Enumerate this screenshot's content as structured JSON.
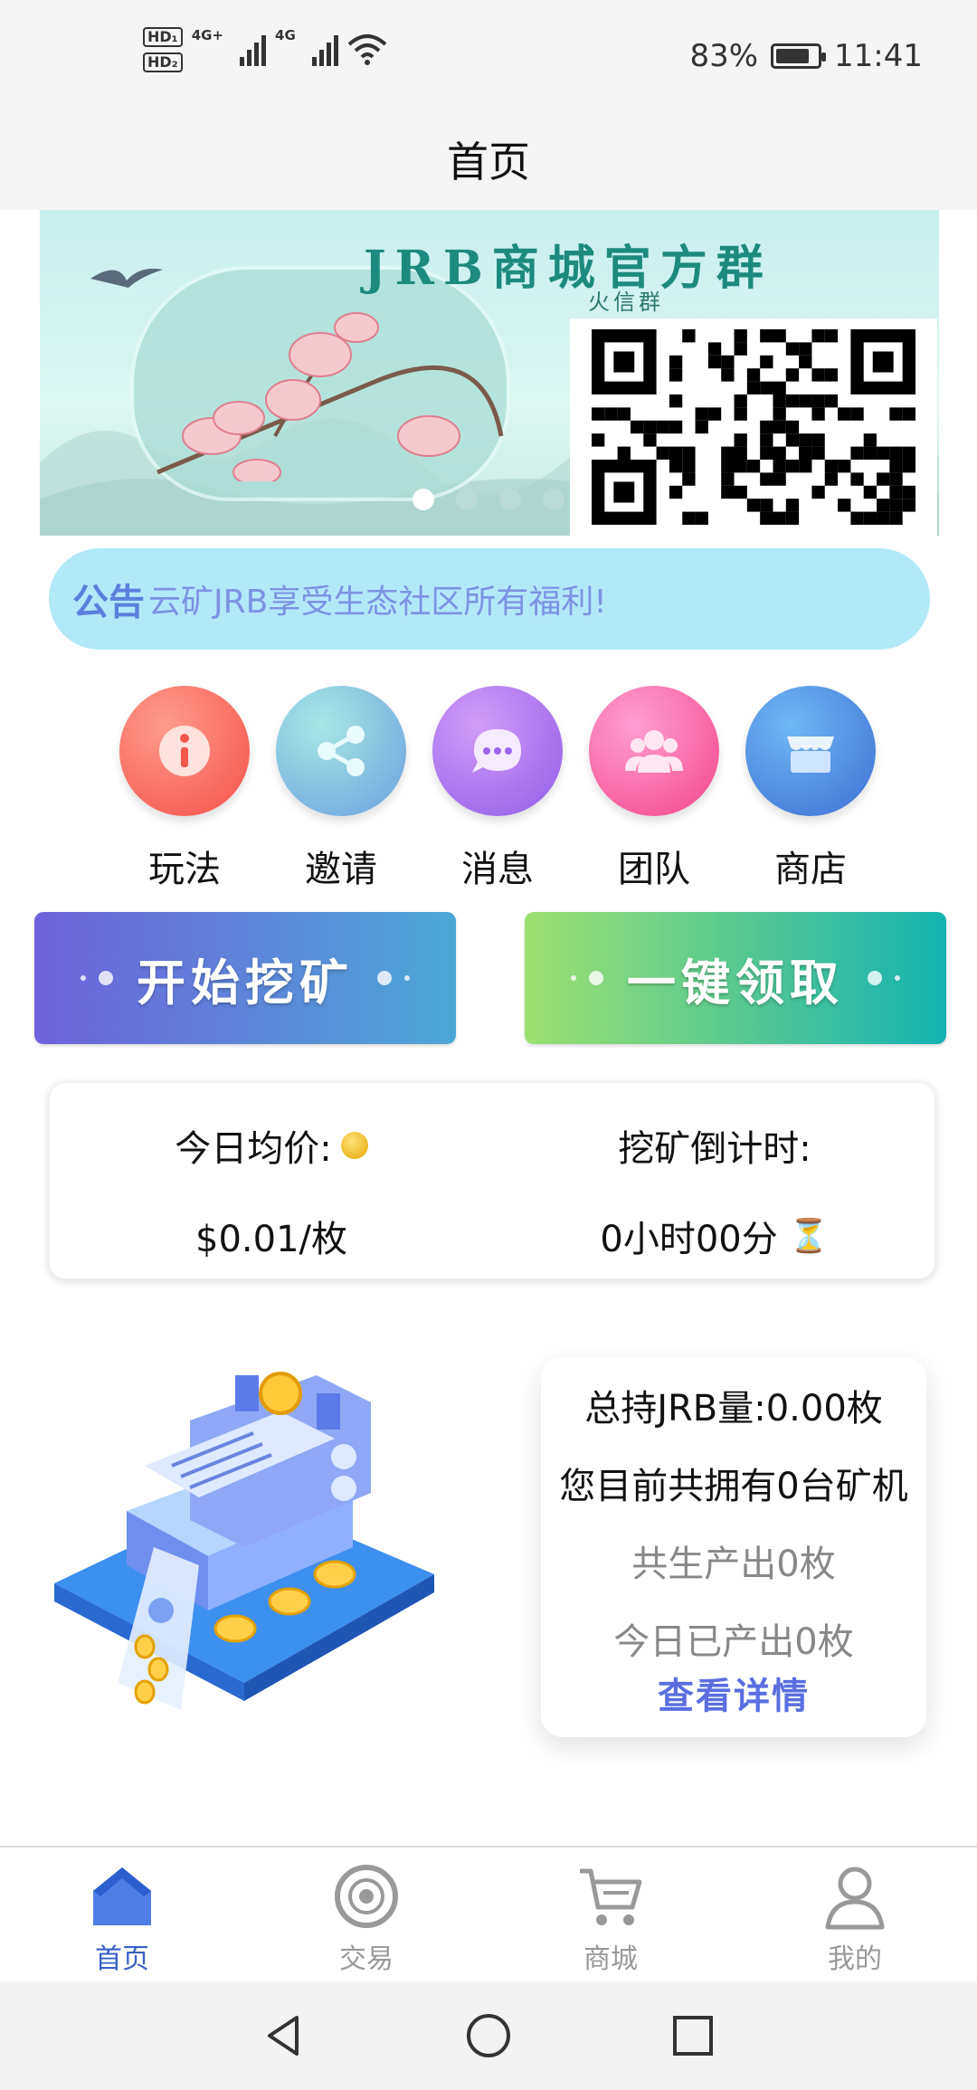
{
  "status_bar": {
    "hd1": "HD₁",
    "hd2": "HD₂",
    "net1": "4G+",
    "net2": "4G",
    "battery_text": "83%",
    "battery_level": 0.83,
    "time": "11:41"
  },
  "header": {
    "title": "首页"
  },
  "banner": {
    "title": "JRB商城官方群",
    "subtitle": "火信群",
    "slide_count": 4,
    "active_slide": 0
  },
  "notice": {
    "tag": "公告",
    "text": "云矿JRB享受生态社区所有福利!"
  },
  "shortcuts": [
    {
      "label": "玩法",
      "icon": "info-icon"
    },
    {
      "label": "邀请",
      "icon": "share-icon"
    },
    {
      "label": "消息",
      "icon": "chat-icon"
    },
    {
      "label": "团队",
      "icon": "team-icon"
    },
    {
      "label": "商店",
      "icon": "store-icon"
    }
  ],
  "actions": {
    "start_mining": "开始挖矿",
    "claim_all": "一键领取"
  },
  "price_card": {
    "avg_price_label": "今日均价:",
    "avg_price_value": "$0.01/枚",
    "countdown_label": "挖矿倒计时:",
    "countdown_value": "0小时00分"
  },
  "stats": {
    "total_holding": "总持JRB量:0.00枚",
    "machines_owned": "您目前共拥有0台矿机",
    "total_output": "共生产出0枚",
    "today_output": "今日已产出0枚",
    "detail_link": "查看详情"
  },
  "bottom_nav": [
    {
      "label": "首页",
      "icon": "home-icon",
      "active": true
    },
    {
      "label": "交易",
      "icon": "trade-icon",
      "active": false
    },
    {
      "label": "商城",
      "icon": "cart-icon",
      "active": false
    },
    {
      "label": "我的",
      "icon": "profile-icon",
      "active": false
    }
  ],
  "colors": {
    "accent": "#3a5fc8",
    "notice_bg": "#b2e9f9",
    "start_btn": "#6f62dc",
    "claim_btn": "#14b2b2"
  }
}
